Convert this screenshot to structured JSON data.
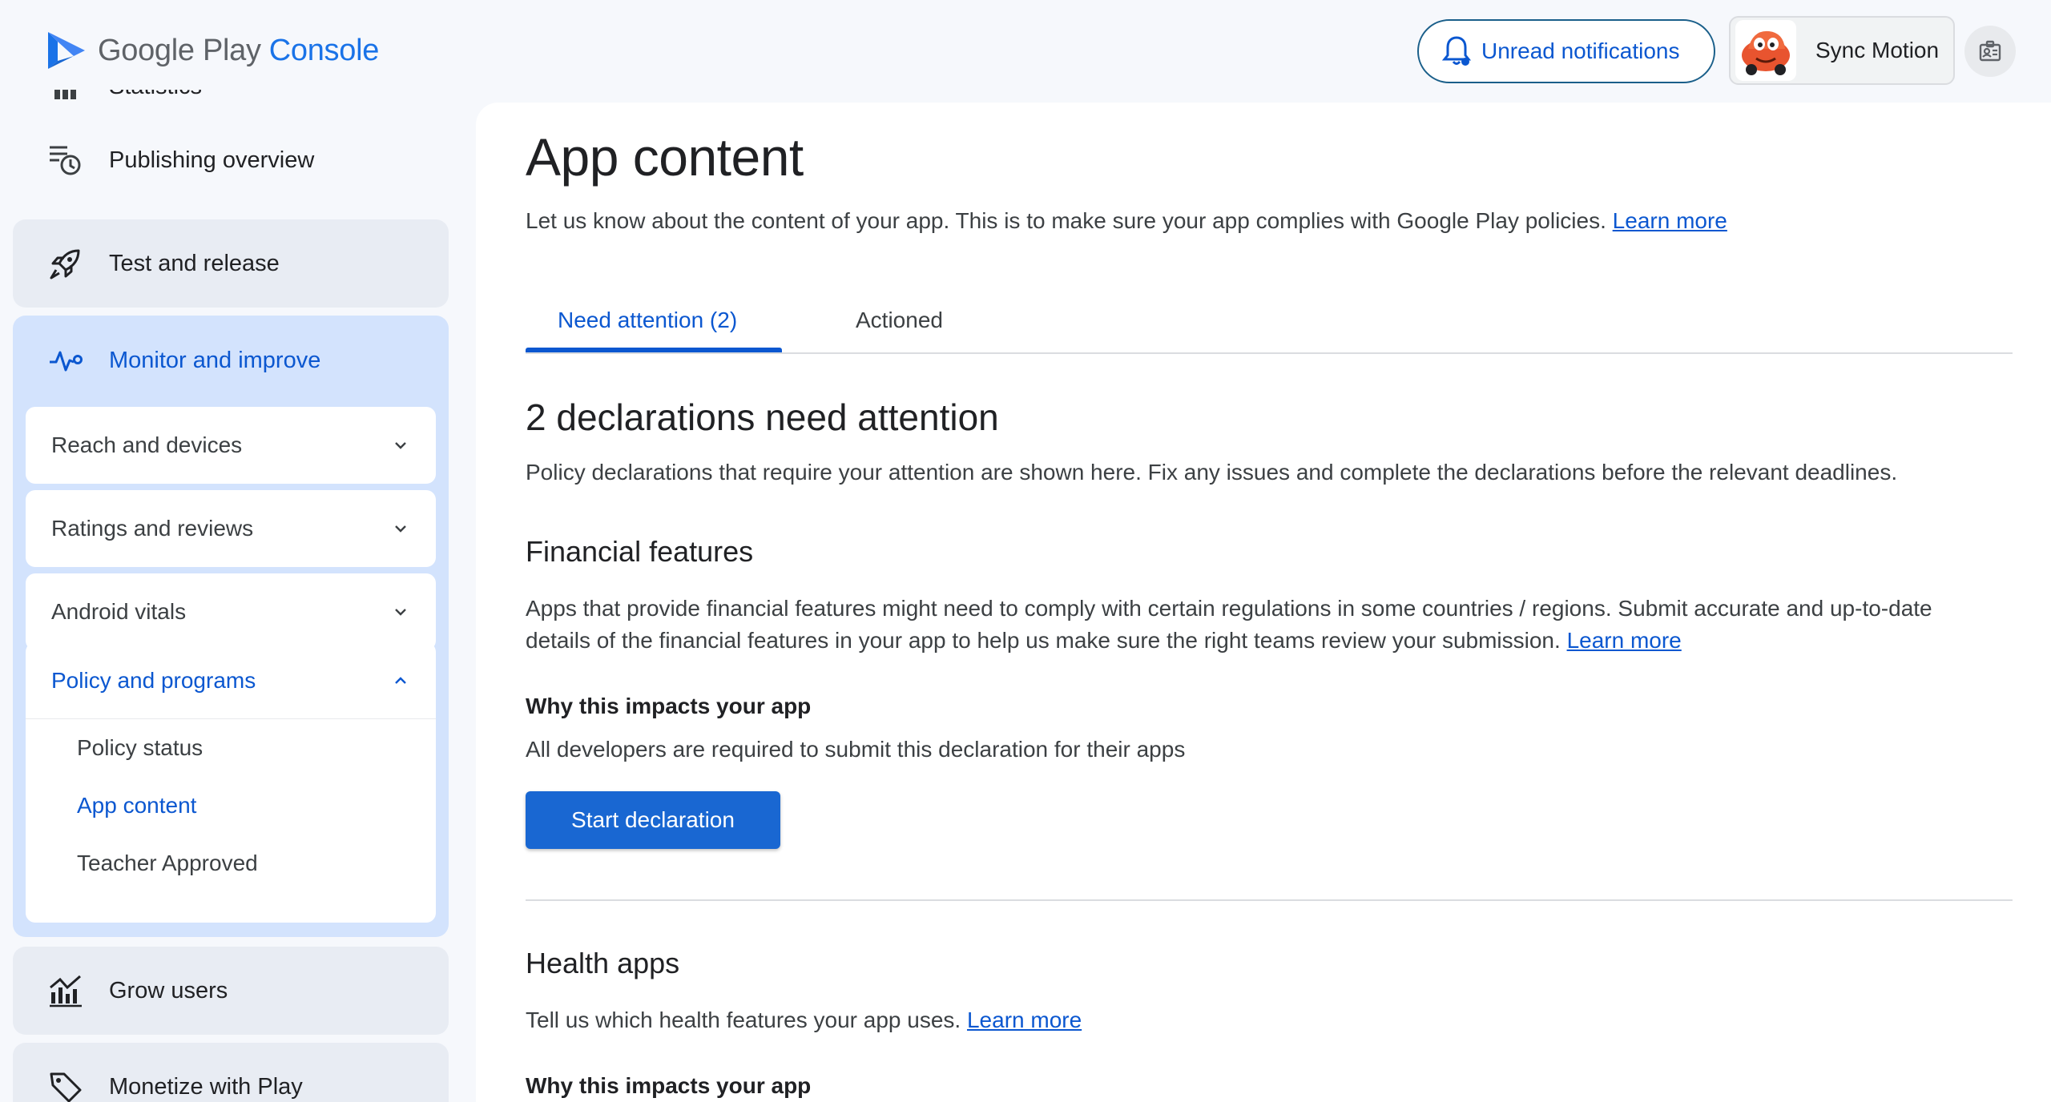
{
  "header": {
    "logo_main": "Google Play",
    "logo_console": "Console",
    "notifications_label": "Unread notifications",
    "account_name": "Sync Motion"
  },
  "sidebar": {
    "statistics_label": "Statistics",
    "publishing_overview": "Publishing overview",
    "test_and_release": "Test and release",
    "monitor_and_improve": "Monitor and improve",
    "reach_and_devices": "Reach and devices",
    "ratings_and_reviews": "Ratings and reviews",
    "android_vitals": "Android vitals",
    "policy_and_programs": "Policy and programs",
    "policy_items": [
      "Policy status",
      "App content",
      "Teacher Approved"
    ],
    "grow_users": "Grow users",
    "monetize_with_play": "Monetize with Play"
  },
  "main": {
    "title": "App content",
    "subtitle": "Let us know about the content of your app. This is to make sure your app complies with Google Play policies.",
    "learn_more": "Learn more",
    "tabs": [
      "Need attention (2)",
      "Actioned"
    ],
    "attention_heading": "2 declarations need attention",
    "attention_desc": "Policy declarations that require your attention are shown here. Fix any issues and complete the declarations before the relevant deadlines.",
    "financial": {
      "heading": "Financial features",
      "desc": "Apps that provide financial features might need to comply with certain regulations in some countries / regions. Submit accurate and up-to-date details of the financial features in your app to help us make sure the right teams review your submission.",
      "learn_more": "Learn more",
      "why_heading": "Why this impacts your app",
      "why_desc": "All developers are required to submit this declaration for their apps",
      "button": "Start declaration"
    },
    "health": {
      "heading": "Health apps",
      "desc": "Tell us which health features your app uses.",
      "learn_more": "Learn more",
      "why_heading": "Why this impacts your app"
    }
  },
  "colors": {
    "accent": "#0b57d0",
    "primary_button": "#1967d2",
    "selected_nav": "#d3e3fd"
  }
}
